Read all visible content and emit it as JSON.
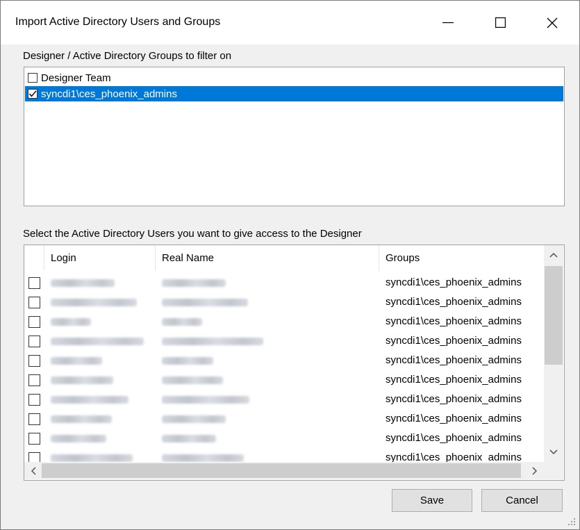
{
  "window": {
    "title": "Import Active Directory Users and Groups",
    "minimize_glyph": "—",
    "maximize_glyph": "☐",
    "close_glyph": "✕"
  },
  "groups_section": {
    "label": "Designer / Active Directory Groups to filter on",
    "items": [
      {
        "label": "Designer Team",
        "checked": false,
        "selected": false
      },
      {
        "label": "syncdi1\\ces_phoenix_admins",
        "checked": true,
        "selected": true
      }
    ]
  },
  "users_section": {
    "label": "Select the Active Directory Users you want to give access to the Designer",
    "columns": [
      "Login",
      "Real Name",
      "Groups"
    ],
    "rows": [
      {
        "checked": false,
        "group": "syncdi1\\ces_phoenix_admins"
      },
      {
        "checked": false,
        "group": "syncdi1\\ces_phoenix_admins"
      },
      {
        "checked": false,
        "group": "syncdi1\\ces_phoenix_admins"
      },
      {
        "checked": false,
        "group": "syncdi1\\ces_phoenix_admins"
      },
      {
        "checked": false,
        "group": "syncdi1\\ces_phoenix_admins"
      },
      {
        "checked": false,
        "group": "syncdi1\\ces_phoenix_admins"
      },
      {
        "checked": false,
        "group": "syncdi1\\ces_phoenix_admins"
      },
      {
        "checked": false,
        "group": "syncdi1\\ces_phoenix_admins"
      },
      {
        "checked": false,
        "group": "syncdi1\\ces_phoenix_admins"
      },
      {
        "checked": false,
        "group": "syncdi1\\ces_phoenix_admins"
      }
    ]
  },
  "buttons": {
    "save": "Save",
    "cancel": "Cancel"
  },
  "colors": {
    "selection": "#0078d7",
    "dialog_background": "#f0f0f0"
  }
}
